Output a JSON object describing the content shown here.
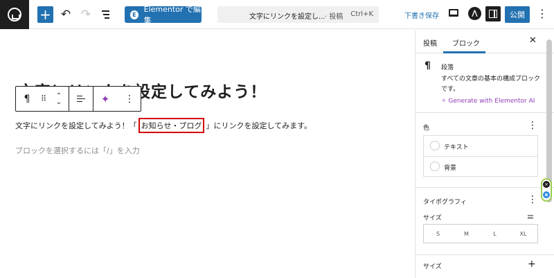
{
  "topbar": {
    "add_label": "+",
    "undo_label": "↶",
    "redo_label": "↷",
    "elementor_label": "Elementor で編集",
    "elementor_icon_text": "E",
    "cmd_title": "文字にリンクを設定し...",
    "cmd_type": "· 投稿",
    "cmd_shortcut": "Ctrl+K",
    "save_draft": "下書き保存",
    "jetpack_text": "⋀",
    "publish": "公開",
    "more": "⋮"
  },
  "canvas": {
    "title": "文字にリンクを設定してみよう！",
    "paragraph_before": "文字にリンクを設定してみよう！「",
    "paragraph_link": "お知らせ・ブログ",
    "paragraph_after": "」にリンクを設定してみます。",
    "placeholder": "ブロックを選択するには「/」を入力"
  },
  "block_toolbar": {
    "pilcrow": "¶",
    "drag": "⠿",
    "move_up": "⌃",
    "move_down": "⌄",
    "ai": "✦",
    "more": "⋮"
  },
  "sidebar": {
    "tab_post": "投稿",
    "tab_block": "ブロック",
    "close": "✕",
    "block_icon": "¶",
    "block_name": "段落",
    "block_desc": "すべての文章の基本の構成ブロックです。",
    "ai_link": "✧ Generate with Elementor AI",
    "color_title": "色",
    "color_text": "テキスト",
    "color_background": "背景",
    "typography_title": "タイポグラフィ",
    "size_label": "サイズ",
    "size_options": [
      "S",
      "M",
      "L",
      "XL"
    ],
    "dimensions_title": "サイズ",
    "dimensions_add": "+",
    "kebab": "⋮"
  },
  "colors": {
    "accent": "#2271b1",
    "link_highlight": "#d10000",
    "ai_purple": "#8e3bb5"
  }
}
